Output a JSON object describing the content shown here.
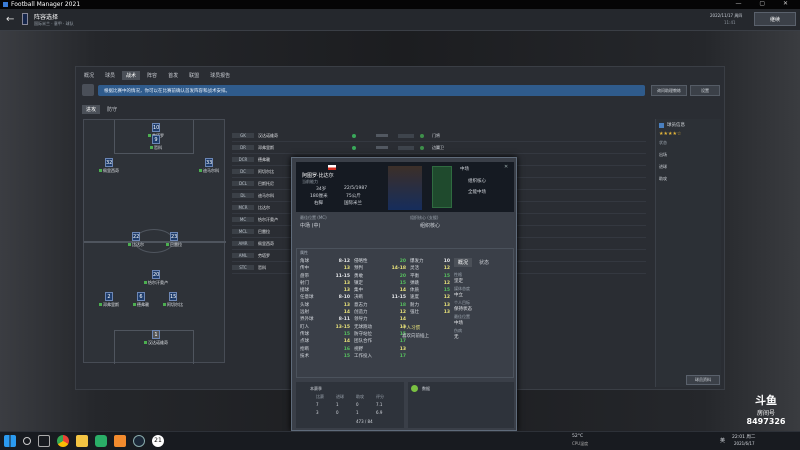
{
  "window": {
    "title": "Football Manager 2021",
    "controls": "— ▢ ✕"
  },
  "topbar": {
    "title": "阵容选择",
    "subtitle": "国际米兰 · 意甲 · 球队",
    "date_line1": "2022/11/17 周四",
    "date_line2": "11:41",
    "continue_label": "继续"
  },
  "tabs": [
    {
      "label": "概况"
    },
    {
      "label": "球员"
    },
    {
      "label": "战术"
    },
    {
      "label": "阵容"
    },
    {
      "label": "首发"
    },
    {
      "label": "联盟"
    },
    {
      "label": "球员报告"
    }
  ],
  "subtabs": [
    {
      "label": "进攻"
    },
    {
      "label": "防守"
    }
  ],
  "notice": {
    "text": "根据比赛中的情况，你可以在比赛前确认首发阵容和战术安排。",
    "button": "询问助理教练",
    "settings": "设置"
  },
  "pitch_players": [
    {
      "num": "1",
      "name": "汉达诺维奇"
    },
    {
      "num": "2",
      "name": "邓弗里斯"
    },
    {
      "num": "6",
      "name": "德弗赖"
    },
    {
      "num": "15",
      "name": "阿切尔比"
    },
    {
      "num": "33",
      "name": "迪马尔科"
    },
    {
      "num": "22",
      "name": "比达尔"
    },
    {
      "num": "20",
      "name": "恰尔汗奥卢"
    },
    {
      "num": "23",
      "name": "巴雷拉"
    },
    {
      "num": "9",
      "name": "哲科"
    },
    {
      "num": "10",
      "name": "劳塔罗"
    },
    {
      "num": "32",
      "name": "佩里西奇"
    }
  ],
  "table_rows": [
    {
      "pos": "GK",
      "name": "汉达诺维奇",
      "role": "门将"
    },
    {
      "pos": "DR",
      "name": "邓弗里斯",
      "role": "边翼卫"
    },
    {
      "pos": "DCR",
      "name": "德弗赖",
      "role": "中后卫"
    },
    {
      "pos": "DC",
      "name": "阿切尔比",
      "role": "中后卫"
    },
    {
      "pos": "DCL",
      "name": "巴斯托尼",
      "role": "中后卫"
    },
    {
      "pos": "DL",
      "name": "迪马尔科",
      "role": "边翼卫"
    },
    {
      "pos": "MCR",
      "name": "比达尔",
      "role": "组织核心"
    },
    {
      "pos": "MC",
      "name": "恰尔汗奥卢",
      "role": "组织核心"
    },
    {
      "pos": "MCL",
      "name": "巴雷拉",
      "role": "全能中场"
    },
    {
      "pos": "AMR",
      "name": "佩里西奇",
      "role": "内锋"
    },
    {
      "pos": "AML",
      "name": "劳塔罗",
      "role": "射手"
    },
    {
      "pos": "STC",
      "name": "哲科",
      "role": "目标中锋"
    }
  ],
  "right_panel": {
    "title": "球员信息",
    "stars": "★★★★☆",
    "rating_label": "状态",
    "items": [
      "出场",
      "进球",
      "助攻"
    ],
    "foot_button": "球员资料"
  },
  "player_card": {
    "name": "阿图罗·比达尔",
    "rating_label": "当前能力",
    "age": "34岁",
    "dob": "22/5/1987",
    "height": "180厘米",
    "weight": "75公斤",
    "foot": "右脚",
    "contract": "国际米兰",
    "position_badge": "中场",
    "role_label": "组织核心",
    "duty_label": "全能中场",
    "best_pos_label": "最佳位置 (MC)",
    "best_pos": "中场 (中)",
    "role_title": "组织核心 (支援)",
    "role_value": "组织核心",
    "attr_header": "属性",
    "technical": [
      {
        "n": "角球",
        "v": "8-12"
      },
      {
        "n": "传中",
        "v": "13"
      },
      {
        "n": "盘带",
        "v": "11-15"
      },
      {
        "n": "射门",
        "v": "13"
      },
      {
        "n": "接球",
        "v": "13"
      },
      {
        "n": "任意球",
        "v": "8-10"
      },
      {
        "n": "头球",
        "v": "13"
      },
      {
        "n": "远射",
        "v": "14"
      },
      {
        "n": "界外球",
        "v": "8-11"
      },
      {
        "n": "盯人",
        "v": "13-15"
      },
      {
        "n": "传球",
        "v": "15"
      },
      {
        "n": "点球",
        "v": "14"
      },
      {
        "n": "抢断",
        "v": "16"
      },
      {
        "n": "技术",
        "v": "15"
      }
    ],
    "mental": [
      {
        "n": "侵略性",
        "v": "20"
      },
      {
        "n": "预判",
        "v": "14-18"
      },
      {
        "n": "勇敢",
        "v": "20"
      },
      {
        "n": "镇定",
        "v": "15"
      },
      {
        "n": "集中",
        "v": "14"
      },
      {
        "n": "决断",
        "v": "11-15"
      },
      {
        "n": "意志力",
        "v": "18"
      },
      {
        "n": "创造力",
        "v": "12"
      },
      {
        "n": "领导力",
        "v": "14"
      },
      {
        "n": "无球跑动",
        "v": "13"
      },
      {
        "n": "防守站位",
        "v": "15"
      },
      {
        "n": "团队合作",
        "v": "17"
      },
      {
        "n": "视野",
        "v": "13"
      },
      {
        "n": "工作投入",
        "v": "17"
      }
    ],
    "physical": [
      {
        "n": "爆发力",
        "v": "10"
      },
      {
        "n": "灵活",
        "v": "12"
      },
      {
        "n": "平衡",
        "v": "15"
      },
      {
        "n": "弹跳",
        "v": "12"
      },
      {
        "n": "体质",
        "v": "15"
      },
      {
        "n": "速度",
        "v": "12"
      },
      {
        "n": "耐力",
        "v": "13"
      },
      {
        "n": "强壮",
        "v": "13"
      }
    ],
    "side_tabs": [
      "概况",
      "状态"
    ],
    "side_info": [
      {
        "k": "性格",
        "v": "坚定"
      },
      {
        "k": "媒体态度",
        "v": "中立"
      },
      {
        "k": "个人目标",
        "v": "保持状态"
      },
      {
        "k": "最佳位置",
        "v": "中场"
      },
      {
        "k": "伤病",
        "v": "无"
      }
    ],
    "traits_title": "个人习惯",
    "traits": "喜欢向前插上",
    "footer_label": "本赛季",
    "footer_stat": "数据",
    "stats_head": [
      "比赛",
      "进球",
      "助攻",
      "评分"
    ],
    "stats": [
      [
        "7",
        "1",
        "0",
        "7.1"
      ],
      [
        "3",
        "0",
        "1",
        "6.9"
      ]
    ],
    "last_line": "473 / 84"
  },
  "taskbar": {
    "temp": "52°C",
    "cpu": "CPU温度",
    "lang": "英",
    "time": "22:01 周二",
    "date": "2021/6/17"
  },
  "watermark": {
    "logo": "斗鱼",
    "label": "房间号",
    "room": "8497326"
  },
  "colors": {
    "accent": "#2d6fb0",
    "good": "#57c15f",
    "highlight": "#e8e27a",
    "shirt": "#1f3d6b"
  }
}
